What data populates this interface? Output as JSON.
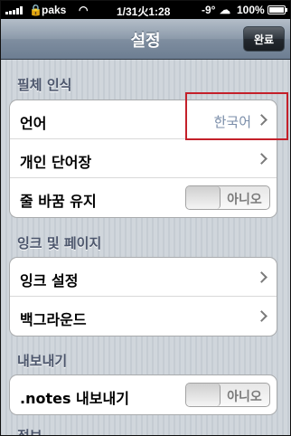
{
  "status_bar": {
    "carrier": "paks",
    "time": "1/31火1:28",
    "temperature": "-9°",
    "battery": "100%"
  },
  "nav": {
    "title": "설정",
    "done_label": "완료"
  },
  "sections": [
    {
      "header": "필체 인식",
      "rows": [
        {
          "label": "언어",
          "value": "한국어",
          "accessory": "chevron"
        },
        {
          "label": "개인 단어장",
          "accessory": "chevron"
        },
        {
          "label": "줄 바꿈 유지",
          "accessory": "toggle",
          "toggle_text": "아니오",
          "toggle_on": false
        }
      ]
    },
    {
      "header": "잉크 및 페이지",
      "rows": [
        {
          "label": "잉크 설정",
          "accessory": "chevron"
        },
        {
          "label": "백그라운드",
          "accessory": "chevron"
        }
      ]
    },
    {
      "header": "내보내기",
      "rows": [
        {
          "label": ".notes 내보내기",
          "accessory": "toggle",
          "toggle_text": "아니오",
          "toggle_on": false
        }
      ]
    },
    {
      "header": "정보",
      "rows": []
    }
  ],
  "icons": {
    "signal": "signal-bars-icon",
    "lock": "lock-icon",
    "wifi": "wifi-icon",
    "weather": "cloud-icon",
    "battery": "battery-icon",
    "chevron": "chevron-right-icon"
  },
  "colors": {
    "highlight": "#c4202a",
    "section_header": "#4c566c",
    "value_text": "#7a8da9"
  }
}
